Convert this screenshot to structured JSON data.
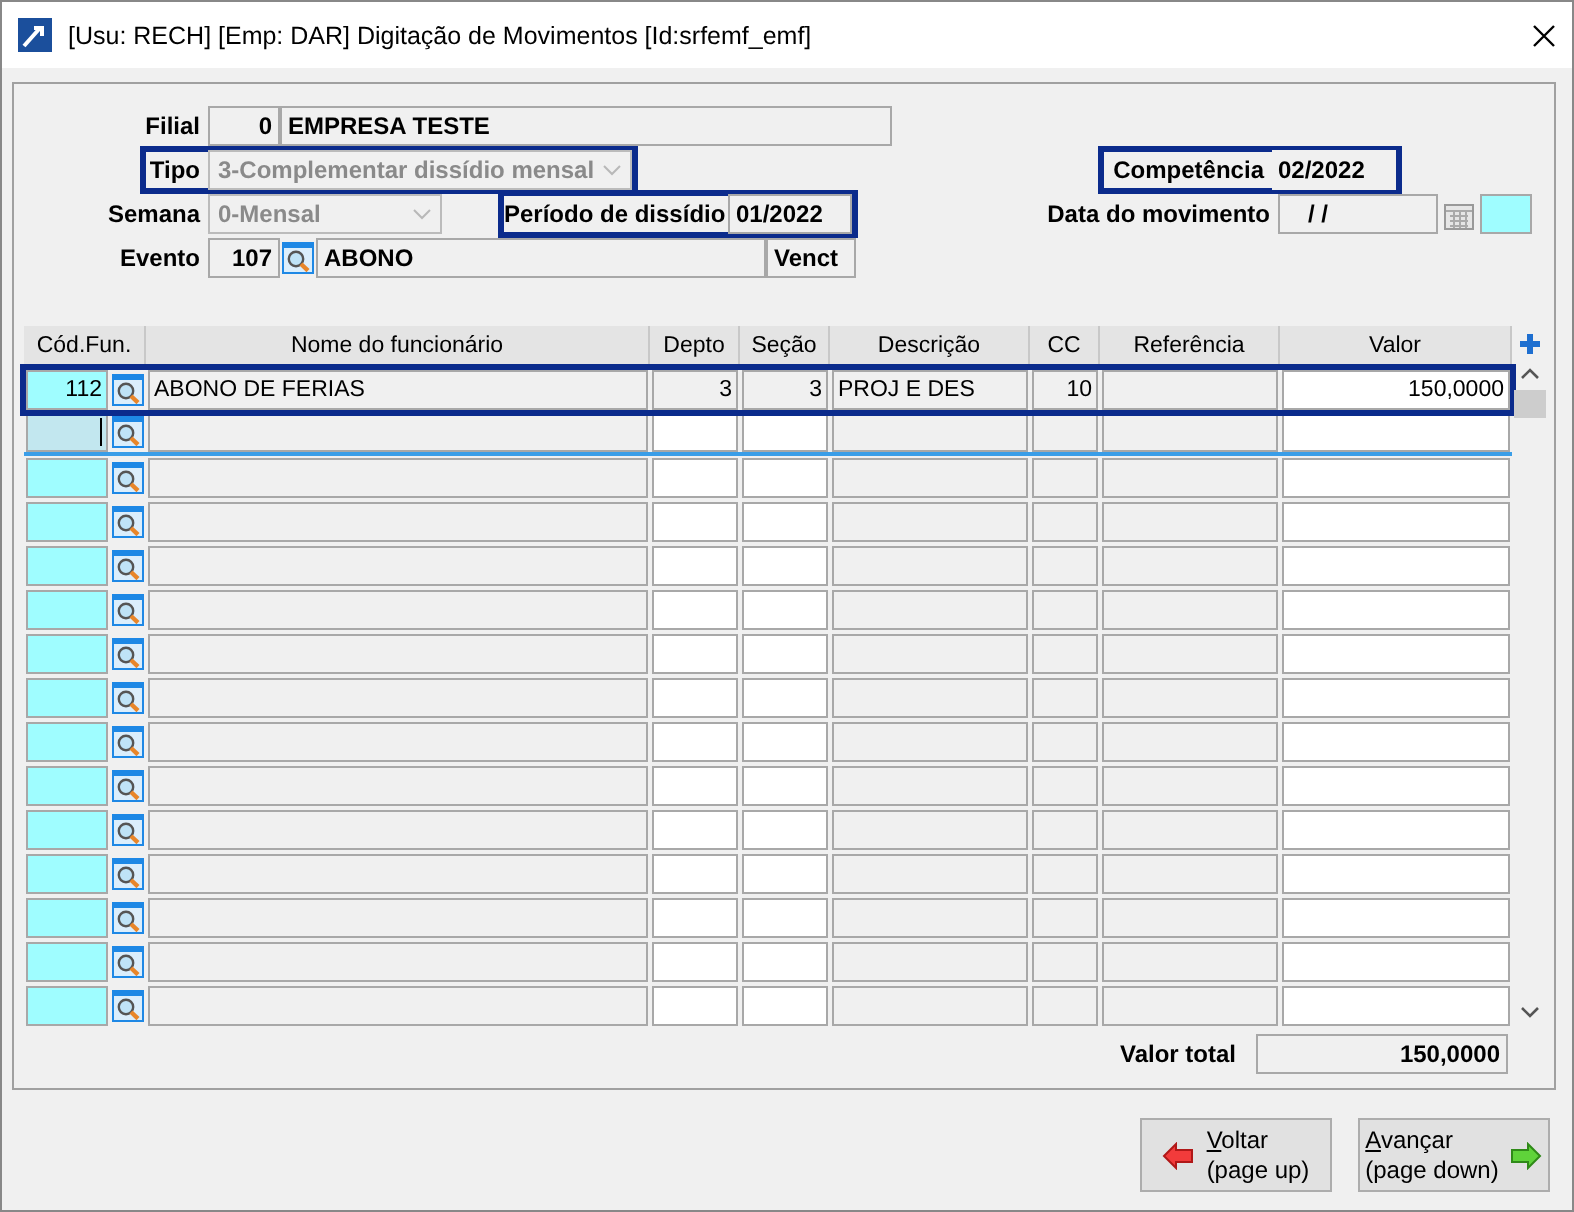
{
  "window": {
    "title": "[Usu: RECH] [Emp: DAR] Digitação de Movimentos [Id:srfemf_emf]"
  },
  "form": {
    "filial": {
      "label": "Filial",
      "code": "0",
      "name": "EMPRESA TESTE"
    },
    "tipo": {
      "label": "Tipo",
      "value": "3-Complementar dissídio mensal",
      "disabled": true,
      "highlighted": true
    },
    "competencia": {
      "label": "Competência",
      "value": "02/2022",
      "highlighted": true
    },
    "semana": {
      "label": "Semana",
      "value": "0-Mensal",
      "disabled": true
    },
    "periodo": {
      "label": "Período de dissídio",
      "value": "01/2022",
      "highlighted": true
    },
    "data_movimento": {
      "label": "Data do movimento",
      "value": "/ /"
    },
    "evento": {
      "label": "Evento",
      "code": "107",
      "name": "ABONO",
      "extra": "Venct"
    }
  },
  "grid": {
    "columns": [
      "Cód.Fun.",
      "Nome do funcionário",
      "Depto",
      "Seção",
      "Descrição",
      "CC",
      "Referência",
      "Valor"
    ],
    "rows": [
      {
        "cod": "112",
        "nome": "ABONO DE FERIAS",
        "depto": "3",
        "secao": "3",
        "descricao": "PROJ E DES",
        "cc": "10",
        "valor": "150,0000",
        "highlighted": true,
        "focused": false
      },
      {
        "highlighted": false,
        "focused": true
      },
      {
        "highlighted": false,
        "focused": false
      },
      {
        "highlighted": false,
        "focused": false
      },
      {
        "highlighted": false,
        "focused": false
      },
      {
        "highlighted": false,
        "focused": false
      },
      {
        "highlighted": false,
        "focused": false
      },
      {
        "highlighted": false,
        "focused": false
      },
      {
        "highlighted": false,
        "focused": false
      },
      {
        "highlighted": false,
        "focused": false
      },
      {
        "highlighted": false,
        "focused": false
      },
      {
        "highlighted": false,
        "focused": false
      },
      {
        "highlighted": false,
        "focused": false
      },
      {
        "highlighted": false,
        "focused": false
      },
      {
        "highlighted": false,
        "focused": false
      }
    ]
  },
  "total": {
    "label": "Valor total",
    "value": "150,0000"
  },
  "buttons": [
    {
      "label": "Voltar",
      "hint": "(page up)",
      "kind": "back"
    },
    {
      "label": "Avançar",
      "hint": "(page down)",
      "kind": "forward"
    }
  ]
}
